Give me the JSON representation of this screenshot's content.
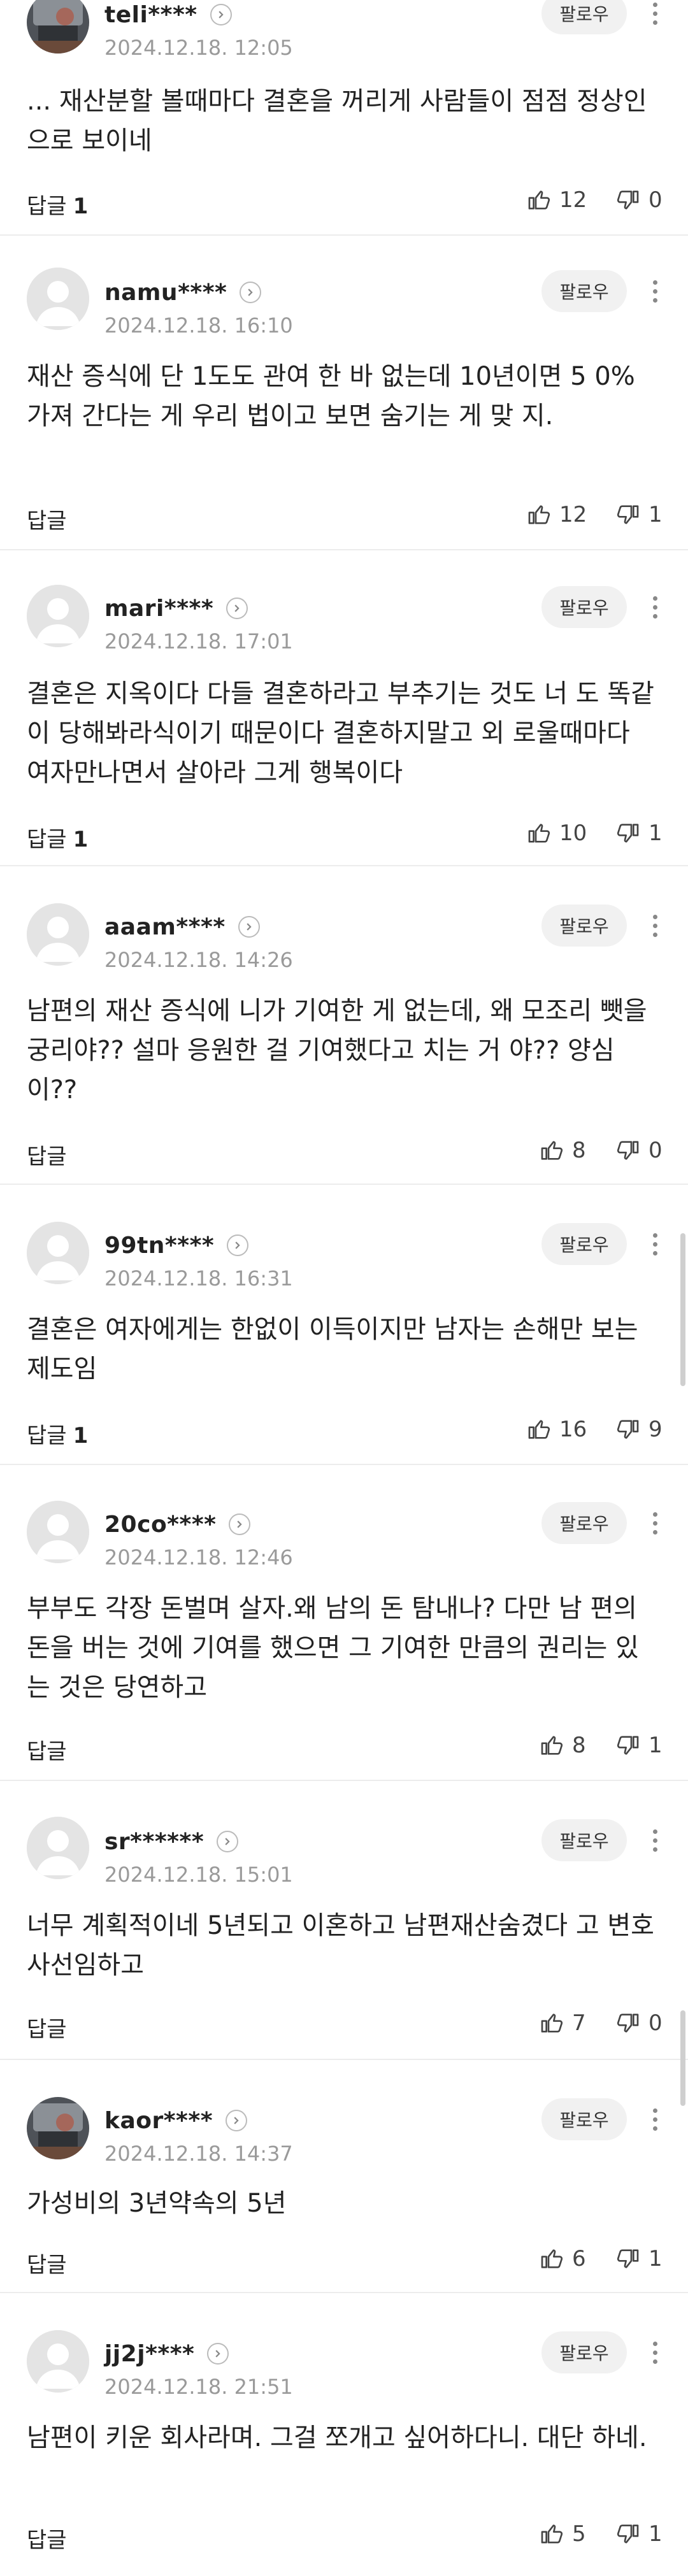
{
  "follow_label": "팔로우",
  "reply_label": "답글",
  "comments": [
    {
      "nick": "teli****",
      "date": "2024.12.18. 12:05",
      "text": "... 재산분할 볼때마다 결혼을 꺼리게 사람들이 점점 정상인으로 보이네",
      "replies": "1",
      "likes": "12",
      "dislikes": "0",
      "avatar": "photo-avatar"
    },
    {
      "nick": "namu****",
      "date": "2024.12.18. 16:10",
      "text": "재산 증식에 단 1도도 관여 한 바 없는데 10년이면 5 0% 가져 간다는 게 우리 법이고 보면 숨기는 게 맞 지.",
      "replies": "",
      "likes": "12",
      "dislikes": "1",
      "avatar": "default-avatar"
    },
    {
      "nick": "mari****",
      "date": "2024.12.18. 17:01",
      "text": "결혼은 지옥이다 다들 결혼하라고 부추기는 것도 너 도 똑같이 당해봐라식이기 때문이다 결혼하지말고 외 로울때마다 여자만나면서 살아라 그게 행복이다",
      "replies": "1",
      "likes": "10",
      "dislikes": "1",
      "avatar": "default-avatar"
    },
    {
      "nick": "aaam****",
      "date": "2024.12.18. 14:26",
      "text": "남편의 재산 증식에 니가 기여한 게 없는데, 왜 모조리 뺏을 궁리야?? 설마 응원한 걸 기여했다고 치는 거 야?? 양심이??",
      "replies": "",
      "likes": "8",
      "dislikes": "0",
      "avatar": "default-avatar"
    },
    {
      "nick": "99tn****",
      "date": "2024.12.18. 16:31",
      "text": "결혼은 여자에게는 한없이 이득이지만 남자는 손해만 보는 제도임",
      "replies": "1",
      "likes": "16",
      "dislikes": "9",
      "avatar": "default-avatar"
    },
    {
      "nick": "20co****",
      "date": "2024.12.18. 12:46",
      "text": "부부도 각장 돈벌며 살자.왜 남의 돈 탐내나? 다만 남 편의 돈을 버는 것에 기여를 했으면 그 기여한 만큼의 권리는 있는 것은 당연하고",
      "replies": "",
      "likes": "8",
      "dislikes": "1",
      "avatar": "default-avatar"
    },
    {
      "nick": "sr******",
      "date": "2024.12.18. 15:01",
      "text": "너무 계획적이네 5년되고 이혼하고 남편재산숨겼다 고 변호사선임하고",
      "replies": "",
      "likes": "7",
      "dislikes": "0",
      "avatar": "default-avatar"
    },
    {
      "nick": "kaor****",
      "date": "2024.12.18. 14:37",
      "text": "가성비의 3년약속의 5년",
      "replies": "",
      "likes": "6",
      "dislikes": "1",
      "avatar": "photo-avatar"
    },
    {
      "nick": "jj2j****",
      "date": "2024.12.18. 21:51",
      "text": "남편이 키운 회사라며. 그걸 쪼개고 싶어하다니. 대단 하네.",
      "replies": "",
      "likes": "5",
      "dislikes": "1",
      "avatar": "default-avatar"
    }
  ]
}
